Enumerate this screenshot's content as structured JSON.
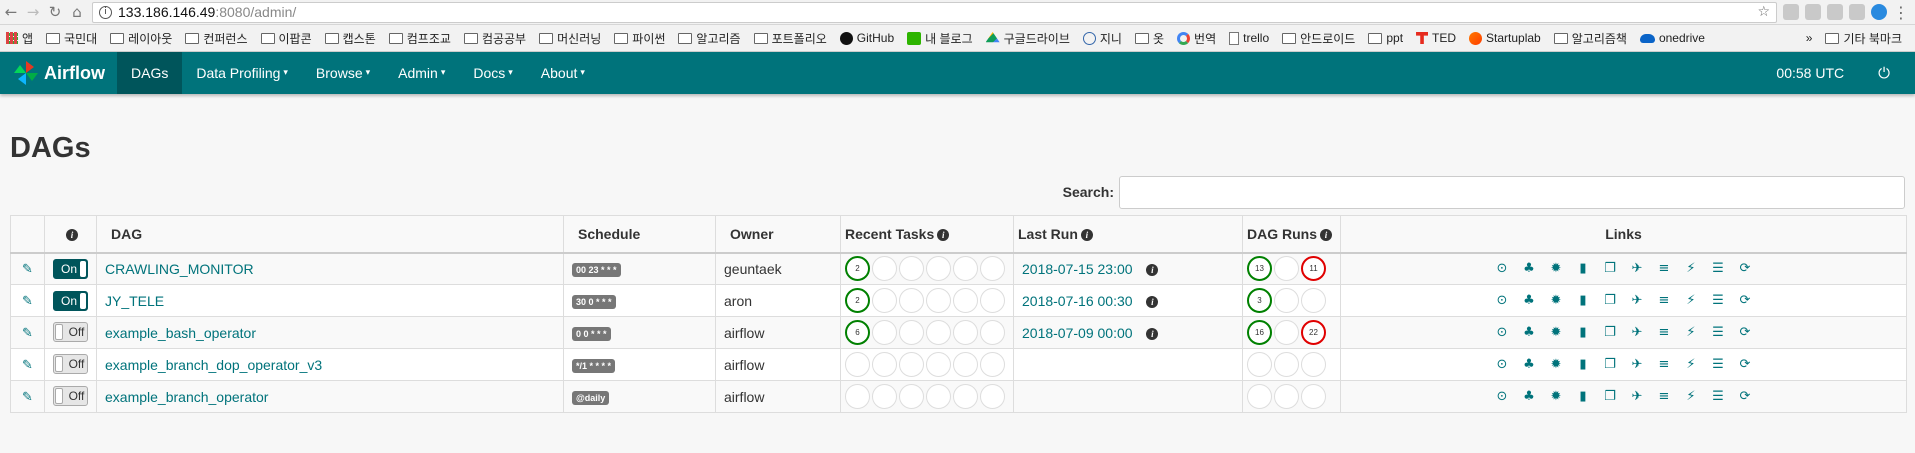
{
  "browser": {
    "url_host": "133.186.146.49",
    "url_path": ":8080/admin/",
    "bookmarks": [
      {
        "label": "앱",
        "icon": "apps"
      },
      {
        "label": "국민대",
        "icon": "folder"
      },
      {
        "label": "레이아웃",
        "icon": "folder"
      },
      {
        "label": "컨퍼런스",
        "icon": "folder"
      },
      {
        "label": "이팝콘",
        "icon": "folder"
      },
      {
        "label": "캡스톤",
        "icon": "folder"
      },
      {
        "label": "컴프조교",
        "icon": "folder"
      },
      {
        "label": "컴공공부",
        "icon": "folder"
      },
      {
        "label": "머신러닝",
        "icon": "folder"
      },
      {
        "label": "파이썬",
        "icon": "folder"
      },
      {
        "label": "알고리즘",
        "icon": "folder"
      },
      {
        "label": "포트폴리오",
        "icon": "folder"
      },
      {
        "label": "GitHub",
        "icon": "gh"
      },
      {
        "label": "내 블로그",
        "icon": "blog"
      },
      {
        "label": "구글드라이브",
        "icon": "drive"
      },
      {
        "label": "지니",
        "icon": "jini"
      },
      {
        "label": "옷",
        "icon": "folder"
      },
      {
        "label": "번역",
        "icon": "g"
      },
      {
        "label": "trello",
        "icon": "page"
      },
      {
        "label": "안드로이드",
        "icon": "folder"
      },
      {
        "label": "ppt",
        "icon": "folder"
      },
      {
        "label": "TED",
        "icon": "ted"
      },
      {
        "label": "Startuplab",
        "icon": "sl"
      },
      {
        "label": "알고리즘책",
        "icon": "folder"
      },
      {
        "label": "onedrive",
        "icon": "od"
      }
    ],
    "more": "»",
    "other_bookmarks": "기타 북마크"
  },
  "navbar": {
    "brand": "Airflow",
    "items": [
      {
        "label": "DAGs",
        "active": true,
        "dropdown": false
      },
      {
        "label": "Data Profiling",
        "active": false,
        "dropdown": true
      },
      {
        "label": "Browse",
        "active": false,
        "dropdown": true
      },
      {
        "label": "Admin",
        "active": false,
        "dropdown": true
      },
      {
        "label": "Docs",
        "active": false,
        "dropdown": true
      },
      {
        "label": "About",
        "active": false,
        "dropdown": true
      }
    ],
    "time": "00:58 UTC"
  },
  "page": {
    "title": "DAGs",
    "search_label": "Search:",
    "search_value": ""
  },
  "table": {
    "headers": {
      "dag": "DAG",
      "schedule": "Schedule",
      "owner": "Owner",
      "recent_tasks": "Recent Tasks",
      "last_run": "Last Run",
      "dag_runs": "DAG Runs",
      "links": "Links"
    },
    "rows": [
      {
        "toggle": "On",
        "dag": "CRAWLING_MONITOR",
        "schedule": "00 23 * * *",
        "owner": "geuntaek",
        "recent_tasks": [
          "2",
          "",
          "",
          "",
          "",
          ""
        ],
        "last_run": "2018-07-15 23:00",
        "dag_runs": [
          "13",
          "",
          "11"
        ]
      },
      {
        "toggle": "On",
        "dag": "JY_TELE",
        "schedule": "30 0 * * *",
        "owner": "aron",
        "recent_tasks": [
          "2",
          "",
          "",
          "",
          "",
          ""
        ],
        "last_run": "2018-07-16 00:30",
        "dag_runs": [
          "3",
          "",
          ""
        ]
      },
      {
        "toggle": "Off",
        "dag": "example_bash_operator",
        "schedule": "0 0 * * *",
        "owner": "airflow",
        "recent_tasks": [
          "6",
          "",
          "",
          "",
          "",
          ""
        ],
        "last_run": "2018-07-09 00:00",
        "dag_runs": [
          "16",
          "",
          "22"
        ]
      },
      {
        "toggle": "Off",
        "dag": "example_branch_dop_operator_v3",
        "schedule": "*/1 * * * *",
        "owner": "airflow",
        "recent_tasks": [
          "",
          "",
          "",
          "",
          "",
          ""
        ],
        "last_run": "",
        "dag_runs": [
          "",
          "",
          ""
        ]
      },
      {
        "toggle": "Off",
        "dag": "example_branch_operator",
        "schedule": "@daily",
        "owner": "airflow",
        "recent_tasks": [
          "",
          "",
          "",
          "",
          "",
          ""
        ],
        "last_run": "",
        "dag_runs": [
          "",
          "",
          ""
        ]
      }
    ],
    "link_icons": [
      "trigger-dag-icon",
      "tree-view-icon",
      "graph-view-icon",
      "task-duration-icon",
      "task-tries-icon",
      "landing-times-icon",
      "gantt-icon",
      "code-view-icon",
      "logs-icon",
      "refresh-icon"
    ],
    "colors": {
      "success": "#008000",
      "failed": "#e00000",
      "accent": "#00737b"
    }
  }
}
